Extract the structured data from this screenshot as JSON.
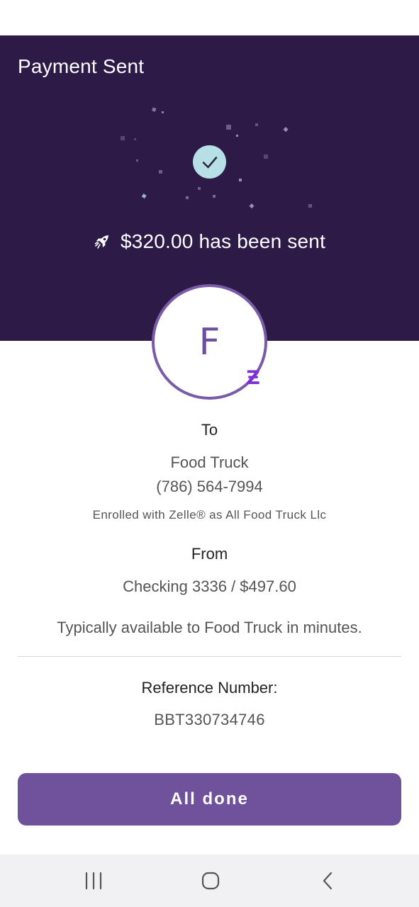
{
  "header": {
    "title": "Payment Sent",
    "sent_message": "$320.00 has been sent"
  },
  "recipient": {
    "avatar_letter": "F",
    "to_label": "To",
    "name": "Food Truck",
    "phone": "(786) 564-7994",
    "enrolled_note": "Enrolled with Zelle® as All Food Truck Llc"
  },
  "sender": {
    "from_label": "From",
    "account": "Checking 3336 / $497.60"
  },
  "availability_note": "Typically available to Food Truck in minutes.",
  "reference": {
    "label": "Reference Number:",
    "value": "BBT330734746"
  },
  "actions": {
    "done_label": "All done"
  },
  "icons": {
    "success": "checkmark-icon",
    "sent": "rocket-icon",
    "zelle": "zelle-logo-icon",
    "nav_recents": "recents-icon",
    "nav_home": "home-icon",
    "nav_back": "back-icon"
  },
  "colors": {
    "hero_background": "#2e1a47",
    "accent_purple": "#6f519c",
    "check_circle": "#b7e0e6",
    "zelle_purple": "#7b2fd6"
  }
}
